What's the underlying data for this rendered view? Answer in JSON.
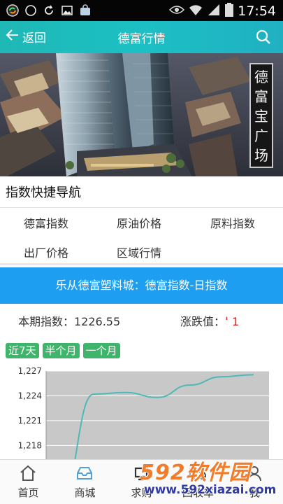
{
  "status_bar": {
    "time": "17:54",
    "icons": [
      "sync-icon",
      "circle-icon",
      "refresh-icon",
      "image-icon",
      "shopping-bag-icon",
      "eye-icon",
      "wifi-icon",
      "signal-icon",
      "battery-icon"
    ]
  },
  "header": {
    "back_label": "返回",
    "title": "德富行情",
    "search_icon": "search-icon"
  },
  "banner": {
    "sign_chars": [
      "德",
      "富",
      "宝",
      "广",
      "场"
    ]
  },
  "quick_nav": {
    "title": "指数快捷导航",
    "items": [
      "德富指数",
      "原油价格",
      "原料指数",
      "出厂价格",
      "区域行情"
    ]
  },
  "index_panel": {
    "header": "乐从德富塑料城：德富指数-日指数",
    "current_label": "本期指数：1226.55",
    "change_label": "涨跌值：",
    "change_value": "1",
    "range_tabs": [
      "近7天",
      "半个月",
      "一个月"
    ]
  },
  "chart_data": {
    "type": "line",
    "title": "",
    "xlabel": "",
    "ylabel": "",
    "y_ticks": [
      "1,227",
      "1,224",
      "1,221",
      "1,218"
    ],
    "ylim": [
      1216,
      1227
    ],
    "x": [
      1,
      2,
      3,
      4,
      5,
      6,
      7
    ],
    "series": [
      {
        "values": [
          1212,
          1224.2,
          1224.4,
          1223.8,
          1225.3,
          1226.3,
          1226.55
        ]
      }
    ],
    "colors": {
      "line": "#4fb8b8",
      "plot_bg": "#c8c8c8"
    },
    "grid": true
  },
  "bottom_nav": {
    "items": [
      {
        "label": "首页",
        "icon": "home-icon"
      },
      {
        "label": "商城",
        "icon": "inbox-icon"
      },
      {
        "label": "求购",
        "icon": "cart-icon"
      },
      {
        "label": "回收车",
        "icon": "truck-icon"
      },
      {
        "label": "我",
        "icon": "user-icon"
      }
    ]
  },
  "watermark": {
    "top": "592软件园",
    "bottom": "www.592xiazai.com"
  },
  "colors": {
    "header": "#1fb8b5",
    "index_header": "#1e9ef1",
    "tab": "#3fb46b",
    "up": "#e02020",
    "watermark_orange": "#f37c2a",
    "watermark_blue": "#2f3aa6"
  }
}
